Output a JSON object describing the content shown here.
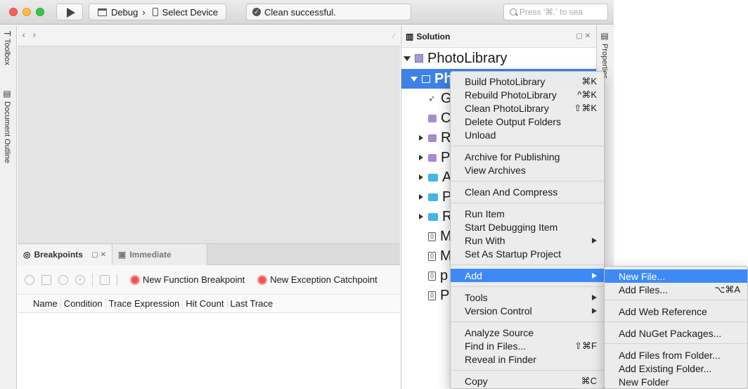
{
  "toolbar": {
    "config_label": "Debug",
    "config_separator": "›",
    "device_label": "Select Device",
    "status_text": "Clean successful.",
    "search_placeholder": "Press '⌘.' to sea"
  },
  "left_dock": {
    "toolbox_label": "Toolbox",
    "outline_label": "Document Outline"
  },
  "right_dock": {
    "properties_label": "Properties"
  },
  "editor": {
    "back_glyph": "‹",
    "forward_glyph": "›"
  },
  "bottom_pad": {
    "tabs": [
      {
        "label": "Breakpoints",
        "icon": "breakpoint-icon"
      },
      {
        "label": "Immediate",
        "icon": "terminal-icon"
      }
    ],
    "actions": [
      {
        "label": "New Function Breakpoint",
        "icon": "function-breakpoint-icon"
      },
      {
        "label": "New Exception Catchpoint",
        "icon": "exception-catchpoint-icon"
      }
    ],
    "columns": [
      "Name",
      "Condition",
      "Trace Expression",
      "Hit Count",
      "Last Trace"
    ]
  },
  "solution": {
    "title": "Solution",
    "root_label": "PhotoLibrary",
    "project_label": "Ph",
    "items": [
      {
        "label": "G",
        "icon": "rocket-icon",
        "expandable": false
      },
      {
        "label": "C",
        "icon": "reference-icon",
        "expandable": false
      },
      {
        "label": "R",
        "icon": "reference-icon",
        "expandable": true
      },
      {
        "label": "P",
        "icon": "reference-icon",
        "expandable": true
      },
      {
        "label": "A",
        "icon": "folder-icon",
        "expandable": true
      },
      {
        "label": "P",
        "icon": "folder-icon",
        "expandable": true
      },
      {
        "label": "R",
        "icon": "folder-icon",
        "expandable": true
      },
      {
        "label": "M",
        "icon": "json-file-icon",
        "expandable": false
      },
      {
        "label": "M",
        "icon": "json-file-icon",
        "expandable": false
      },
      {
        "label": "p",
        "icon": "json-file-icon",
        "expandable": false
      },
      {
        "label": "P",
        "icon": "json-file-icon",
        "expandable": false
      }
    ]
  },
  "context_menu": {
    "items": [
      {
        "label": "Build PhotoLibrary",
        "shortcut": "⌘K"
      },
      {
        "label": "Rebuild PhotoLibrary",
        "shortcut": "^⌘K"
      },
      {
        "label": "Clean PhotoLibrary",
        "shortcut": "⇧⌘K"
      },
      {
        "label": "Delete Output Folders",
        "shortcut": ""
      },
      {
        "label": "Unload",
        "shortcut": ""
      },
      {
        "label": "Archive for Publishing",
        "shortcut": ""
      },
      {
        "label": "View Archives",
        "shortcut": ""
      },
      {
        "label": "Clean And Compress",
        "shortcut": ""
      },
      {
        "label": "Run Item",
        "shortcut": ""
      },
      {
        "label": "Start Debugging Item",
        "shortcut": ""
      },
      {
        "label": "Run With",
        "shortcut": ""
      },
      {
        "label": "Set As Startup Project",
        "shortcut": ""
      },
      {
        "label": "Add",
        "shortcut": ""
      },
      {
        "label": "Tools",
        "shortcut": ""
      },
      {
        "label": "Version Control",
        "shortcut": ""
      },
      {
        "label": "Analyze Source",
        "shortcut": ""
      },
      {
        "label": "Find in Files...",
        "shortcut": "⇧⌘F"
      },
      {
        "label": "Reveal in Finder",
        "shortcut": ""
      },
      {
        "label": "Copy",
        "shortcut": "⌘C"
      }
    ]
  },
  "add_submenu": {
    "items": [
      {
        "label": "New File...",
        "shortcut": ""
      },
      {
        "label": "Add Files...",
        "shortcut": "⌥⌘A"
      },
      {
        "label": "Add Web Reference",
        "shortcut": ""
      },
      {
        "label": "Add NuGet Packages...",
        "shortcut": ""
      },
      {
        "label": "Add Files from Folder...",
        "shortcut": ""
      },
      {
        "label": "Add Existing Folder...",
        "shortcut": ""
      },
      {
        "label": "New Folder",
        "shortcut": ""
      }
    ]
  },
  "colors": {
    "selection": "#3e82e5",
    "menu_highlight": "#3d8af7",
    "folder": "#43b5e6",
    "reference": "#a68ad4"
  }
}
